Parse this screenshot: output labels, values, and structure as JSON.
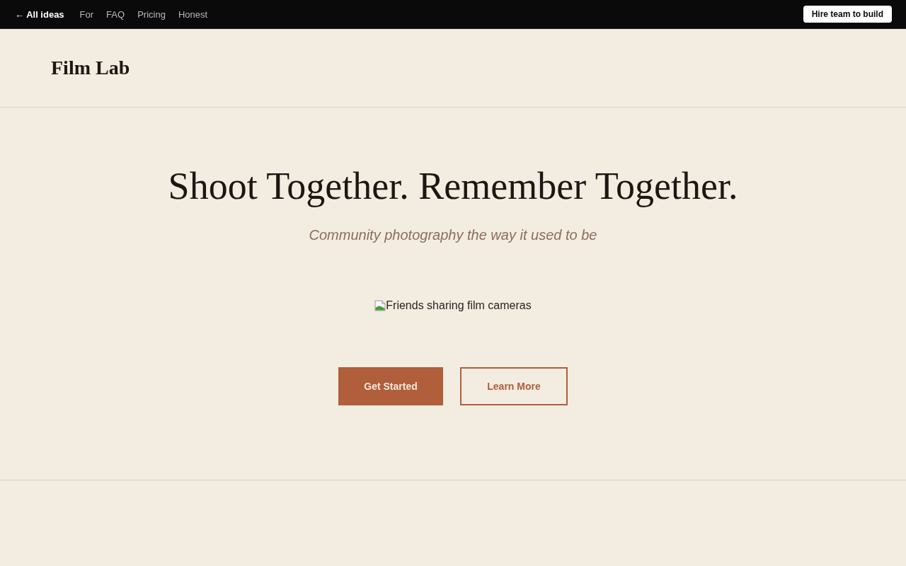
{
  "top_bar": {
    "back_link": "← All ideas",
    "links": [
      "For",
      "FAQ",
      "Pricing",
      "Honest"
    ],
    "cta": "Hire team to build"
  },
  "header": {
    "logo": "Film Lab"
  },
  "hero": {
    "title": "Shoot Together. Remember Together.",
    "subtitle": "Community photography the way it used to be",
    "image": {
      "alt": "Friends sharing film cameras"
    },
    "buttons": [
      {
        "label": "Get Started",
        "kind": "primary"
      },
      {
        "label": "Learn More",
        "kind": "secondary"
      }
    ]
  }
}
